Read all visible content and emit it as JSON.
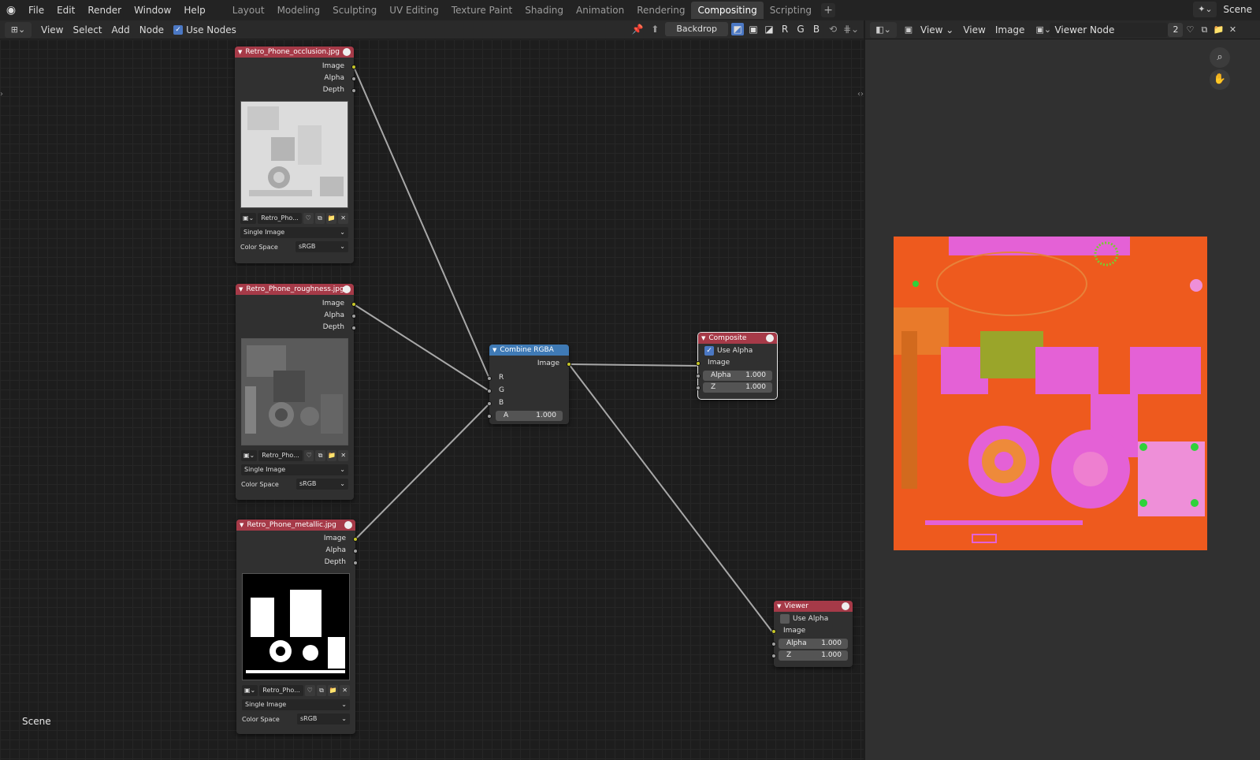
{
  "topbar": {
    "menus": [
      "File",
      "Edit",
      "Render",
      "Window",
      "Help"
    ],
    "workspaces": [
      "Layout",
      "Modeling",
      "Sculpting",
      "UV Editing",
      "Texture Paint",
      "Shading",
      "Animation",
      "Rendering",
      "Compositing",
      "Scripting"
    ],
    "active_workspace": "Compositing",
    "add_tab": "+",
    "scene_name": "Scene"
  },
  "node_editor": {
    "header_menus": [
      "View",
      "Select",
      "Add",
      "Node"
    ],
    "use_nodes_label": "Use Nodes",
    "use_nodes_checked": true,
    "backdrop_label": "Backdrop",
    "channels": [
      "R",
      "G",
      "B"
    ],
    "scene_label": "Scene"
  },
  "image_nodes": [
    {
      "title": "Retro_Phone_occlusion.jpg",
      "outputs": [
        "Image",
        "Alpha",
        "Depth"
      ],
      "image_name": "Retro_Pho...",
      "source": "Single Image",
      "color_space_label": "Color Space",
      "color_space": "sRGB",
      "thumb": "occlusion"
    },
    {
      "title": "Retro_Phone_roughness.jpg",
      "outputs": [
        "Image",
        "Alpha",
        "Depth"
      ],
      "image_name": "Retro_Pho...",
      "source": "Single Image",
      "color_space_label": "Color Space",
      "color_space": "sRGB",
      "thumb": "roughness"
    },
    {
      "title": "Retro_Phone_metallic.jpg",
      "outputs": [
        "Image",
        "Alpha",
        "Depth"
      ],
      "image_name": "Retro_Pho...",
      "source": "Single Image",
      "color_space_label": "Color Space",
      "color_space": "sRGB",
      "thumb": "metallic"
    }
  ],
  "combine_node": {
    "title": "Combine RGBA",
    "output": "Image",
    "inputs": [
      "R",
      "G",
      "B"
    ],
    "a_label": "A",
    "a_value": "1.000"
  },
  "composite_node": {
    "title": "Composite",
    "use_alpha_label": "Use Alpha",
    "use_alpha": true,
    "input": "Image",
    "alpha_label": "Alpha",
    "alpha_value": "1.000",
    "z_label": "Z",
    "z_value": "1.000"
  },
  "viewer_node": {
    "title": "Viewer",
    "use_alpha_label": "Use Alpha",
    "use_alpha": false,
    "input": "Image",
    "alpha_label": "Alpha",
    "alpha_value": "1.000",
    "z_label": "Z",
    "z_value": "1.000"
  },
  "image_viewer": {
    "view_dropdown": "View",
    "menus": [
      "View",
      "Image"
    ],
    "image_name": "Viewer Node",
    "users_count": "2"
  },
  "colors": {
    "image_node_header": "#a63a48",
    "converter_node_header": "#3f7ab5",
    "image_socket": "#c7c729",
    "value_socket": "#a0a0a0",
    "accent": "#4b78c4"
  }
}
